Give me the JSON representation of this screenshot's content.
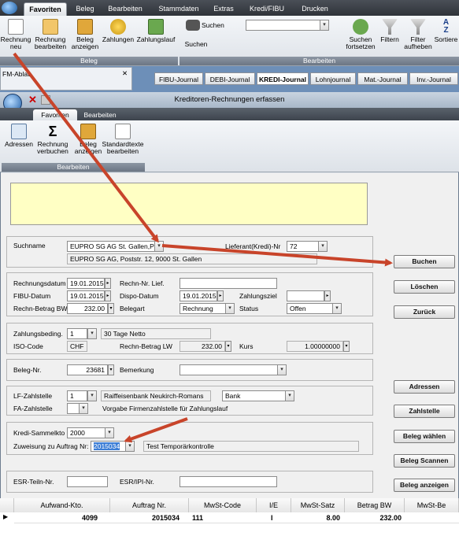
{
  "outer": {
    "tabs": [
      "Favoriten",
      "Beleg",
      "Bearbeiten",
      "Stammdaten",
      "Extras",
      "Kredi/FIBU",
      "Drucken"
    ],
    "ribbon": {
      "rechnung_neu": "Rechnung\nneu",
      "rechnung_bearbeiten": "Rechnung\nbearbeiten",
      "beleg_anzeigen": "Beleg\nanzeigen",
      "zahlungen": "Zahlungen",
      "zahlungslauf": "Zahlungslauf",
      "group_beleg": "Beleg",
      "suchen_label": "Suchen",
      "suchen_btn": "Suchen",
      "suchen_fortsetzen": "Suchen\nfortsetzen",
      "filtern": "Filtern",
      "filter_aufheben": "Filter\naufheben",
      "sortieren": "Sortiere",
      "group_bearbeiten": "Bearbeiten"
    },
    "left_pane_title": "FM-Ablau",
    "journal_tabs": [
      "FIBU-Journal",
      "DEBI-Journal",
      "KREDI-Journal",
      "Lohnjournal",
      "Mat.-Journal",
      "Inv.-Journal"
    ]
  },
  "window": {
    "title": "Kreditoren-Rechnungen erfassen",
    "tabs": [
      "Favoriten",
      "Bearbeiten"
    ],
    "ribbon": {
      "adressen": "Adressen",
      "rechnung_verbuchen": "Rechnung\nverbuchen",
      "beleg_anzeigen": "Beleg\nanzeigen",
      "standardtexte": "Standardtexte\nbearbeiten",
      "group": "Bearbeiten"
    }
  },
  "form": {
    "suchname_label": "Suchname",
    "suchname_value": "EUPRO SG AG St. Gallen,Poststr",
    "lieferant_label": "Lieferant(Kredi)-Nr",
    "lieferant_value": "72",
    "address": "EUPRO SG AG, Poststr. 12, 9000 St. Gallen",
    "rechnungsdatum_label": "Rechnungsdatum",
    "rechnungsdatum": "19.01.2015",
    "rechn_nr_label": "Rechn-Nr. Lief.",
    "fibu_datum_label": "FIBU-Datum",
    "fibu_datum": "19.01.2015",
    "dispo_label": "Dispo-Datum",
    "dispo_datum": "19.01.2015",
    "zahlungsziel_label": "Zahlungsziel",
    "rechn_betrag_bw_label": "Rechn-Betrag BW",
    "rechn_betrag_bw": "232.00",
    "belegart_label": "Belegart",
    "belegart": "Rechnung",
    "status_label": "Status",
    "status": "Offen",
    "zahlungsbed_label": "Zahlungsbeding.",
    "zahlungsbed": "1",
    "zahlungsbed_text": "30 Tage Netto",
    "iso_label": "ISO-Code",
    "iso": "CHF",
    "rechn_betrag_lw_label": "Rechn-Betrag LW",
    "rechn_betrag_lw": "232.00",
    "kurs_label": "Kurs",
    "kurs": "1.00000000",
    "beleg_nr_label": "Beleg-Nr.",
    "beleg_nr": "23681",
    "bemerkung_label": "Bemerkung",
    "lf_zahlstelle_label": "LF-Zahlstelle",
    "lf_zahlstelle": "1",
    "lf_bank_text": "Raiffeisenbank Neukirch-Romans",
    "lf_bank_type": "Bank",
    "fa_zahlstelle_label": "FA-Zahlstelle",
    "fa_text": "Vorgabe Firmenzahlstelle für Zahlungslauf",
    "kredi_sammelkto_label": "Kredi-Sammelkto",
    "kredi_sammelkto": "2000",
    "zuweisung_label": "Zuweisung zu Auftrag Nr:",
    "zuweisung": "2015034",
    "zuweisung_text": "Test Temporärkontrolle",
    "esr_teiln_label": "ESR-Teiln-Nr.",
    "esr_ipi_label": "ESR/IPI-Nr."
  },
  "buttons": [
    "Buchen",
    "Löschen",
    "Zurück",
    "Adressen",
    "Zahlstelle",
    "Beleg wählen",
    "Beleg Scannen",
    "Beleg anzeigen"
  ],
  "grid": {
    "headers": [
      "Aufwand-Kto.",
      "Auftrag Nr.",
      "MwSt-Code",
      "I/E",
      "MwSt-Satz",
      "Betrag BW",
      "MwSt-Be"
    ],
    "row": [
      "4099",
      "2015034",
      "111",
      "I",
      "8.00",
      "232.00",
      ""
    ]
  },
  "colors": {
    "annotation_arrow": "#c8442a",
    "notice_bg": "#ffffc4"
  }
}
